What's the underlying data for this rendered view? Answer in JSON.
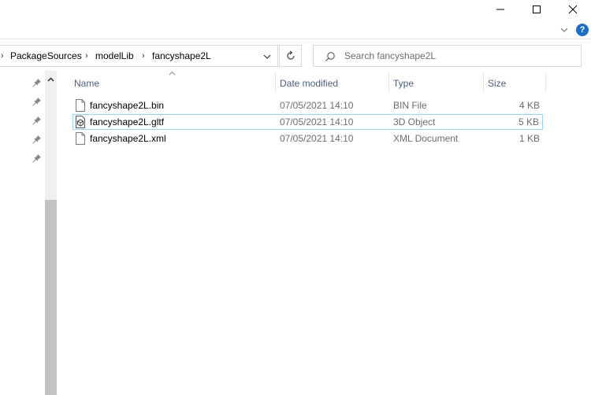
{
  "window": {
    "minimize_icon": "minimize-icon",
    "maximize_icon": "maximize-icon",
    "close_icon": "close-icon",
    "help_label": "?"
  },
  "address": {
    "crumbs": [
      "PackageSources",
      "modelLib",
      "fancyshape2L"
    ],
    "separator": "›"
  },
  "search": {
    "placeholder": "Search fancyshape2L"
  },
  "columns": {
    "name": "Name",
    "date": "Date modified",
    "type": "Type",
    "size": "Size"
  },
  "files": [
    {
      "name": "fancyshape2L.bin",
      "date": "07/05/2021 14:10",
      "type": "BIN File",
      "size": "4 KB",
      "icon": "file-icon",
      "selected": false
    },
    {
      "name": "fancyshape2L.gltf",
      "date": "07/05/2021 14:10",
      "type": "3D Object",
      "size": "5 KB",
      "icon": "3d-object-icon",
      "selected": true
    },
    {
      "name": "fancyshape2L.xml",
      "date": "07/05/2021 14:10",
      "type": "XML Document",
      "size": "1 KB",
      "icon": "file-icon",
      "selected": false
    }
  ],
  "colors": {
    "accent": "#1c6fc7",
    "selection_border": "#99d1ff",
    "header_text": "#4c607a"
  }
}
